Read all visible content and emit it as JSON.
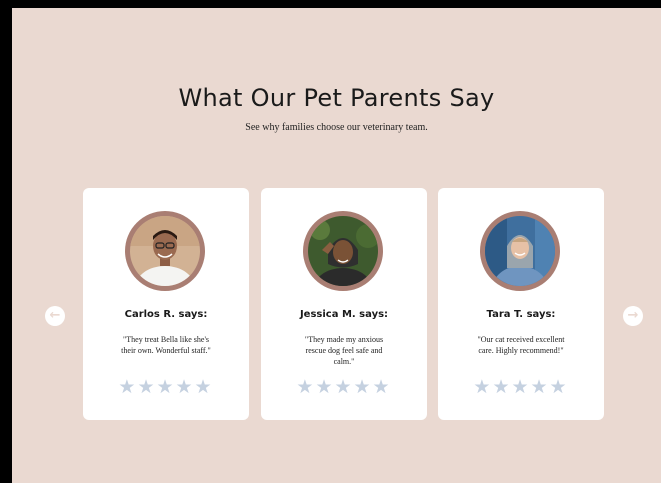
{
  "header": {
    "title": "What Our Pet Parents Say",
    "subtitle": "See why families choose our veterinary team."
  },
  "carousel": {
    "prev_icon": "arrow-left-icon",
    "next_icon": "arrow-right-icon",
    "testimonials": [
      {
        "name": "Carlos R. says:",
        "quote": "\"They treat Bella like she's their own. Wonderful staff.\"",
        "stars": "★★★★★",
        "rating_shown": 5
      },
      {
        "name": "Jessica M. says:",
        "quote": "\"They made my anxious rescue dog feel safe and calm.\"",
        "stars": "★★★★★",
        "rating_shown": 5
      },
      {
        "name": "Tara T. says:",
        "quote": "\"Our cat received excellent care. Highly recommend!\"",
        "stars": "★★★★★",
        "rating_shown": 5
      }
    ]
  },
  "colors": {
    "page_background": "#ead9d1",
    "card_background": "#ffffff",
    "avatar_ring": "#a97e73",
    "star_color": "#c5d1e0"
  }
}
